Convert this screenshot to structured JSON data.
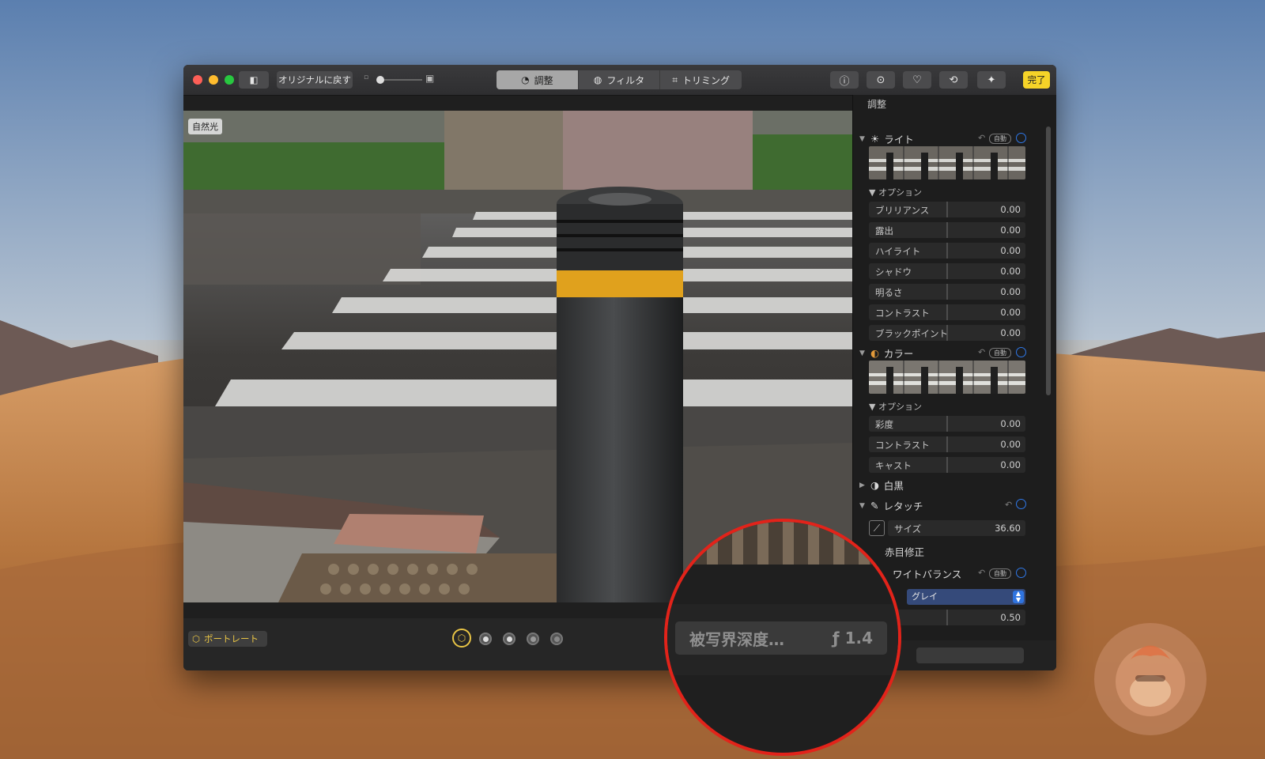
{
  "toolbar": {
    "revert_label": "オリジナルに戻す",
    "tabs": [
      {
        "label": "調整",
        "icon": "adjust-icon",
        "active": true
      },
      {
        "label": "フィルタ",
        "icon": "filter-icon",
        "active": false
      },
      {
        "label": "トリミング",
        "icon": "crop-icon",
        "active": false
      }
    ],
    "done_label": "完了",
    "accent_color": "#f5d328"
  },
  "photo": {
    "lighting_badge": "自然光"
  },
  "bottom_bar": {
    "portrait_label": "ポートレート",
    "lighting_options": [
      "natural-light",
      "studio-light",
      "contour-light",
      "stage-light",
      "stage-light-mono"
    ]
  },
  "sidebar": {
    "title": "調整",
    "auto_label": "自動",
    "options_label": "オプション",
    "light": {
      "label": "ライト",
      "rows": [
        {
          "label": "ブリリアンス",
          "value": "0.00"
        },
        {
          "label": "露出",
          "value": "0.00"
        },
        {
          "label": "ハイライト",
          "value": "0.00"
        },
        {
          "label": "シャドウ",
          "value": "0.00"
        },
        {
          "label": "明るさ",
          "value": "0.00"
        },
        {
          "label": "コントラスト",
          "value": "0.00"
        },
        {
          "label": "ブラックポイント",
          "value": "0.00"
        }
      ]
    },
    "color": {
      "label": "カラー",
      "rows": [
        {
          "label": "彩度",
          "value": "0.00"
        },
        {
          "label": "コントラスト",
          "value": "0.00"
        },
        {
          "label": "キャスト",
          "value": "0.00"
        }
      ]
    },
    "bw": {
      "label": "白黒"
    },
    "retouch": {
      "label": "レタッチ",
      "size_label": "サイズ",
      "size_value": "36.60"
    },
    "redeye": {
      "label": "赤目修正"
    },
    "white_balance": {
      "label": "ワイトバランス",
      "select_value": "グレイ",
      "value": "0.50"
    },
    "scrollbar_color": "#4a4a4a"
  },
  "magnifier": {
    "depth_label": "被写界深度…",
    "aperture": "ƒ 1.4",
    "ring_color": "#e2231a"
  }
}
